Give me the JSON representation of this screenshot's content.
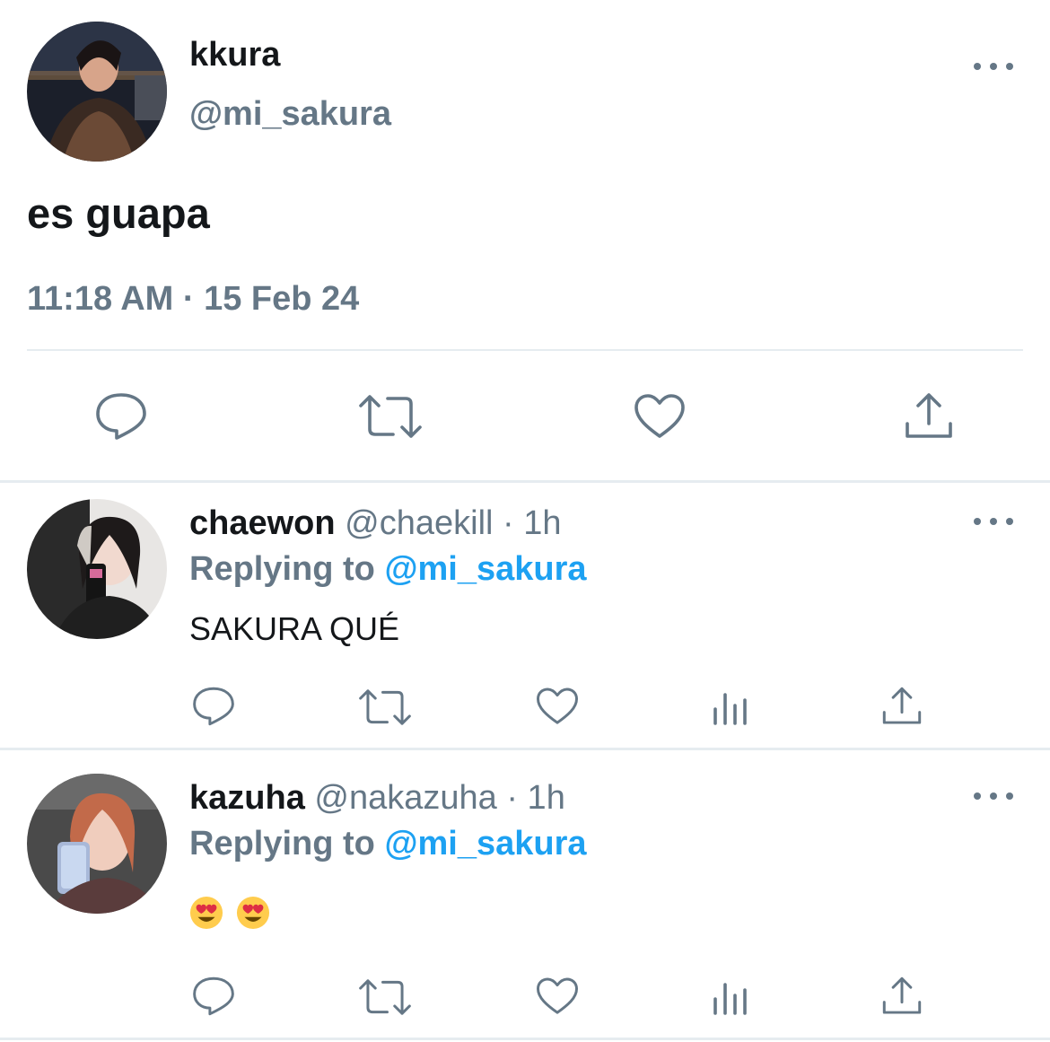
{
  "main_tweet": {
    "display_name": "kkura",
    "handle": "@mi_sakura",
    "text": "es guapa",
    "timestamp": "11:18 AM · 15 Feb 24",
    "avatar_icon": "avatar-photo"
  },
  "replies": [
    {
      "display_name": "chaewon",
      "handle": "@chaekill",
      "time": "· 1h",
      "replying_label": "Replying to",
      "replying_handle": "@mi_sakura",
      "text": "SAKURA QUÉ"
    },
    {
      "display_name": "kazuha",
      "handle": "@nakazuha",
      "time": "· 1h",
      "replying_label": "Replying to",
      "replying_handle": "@mi_sakura",
      "text": "",
      "emojis": [
        "heart-eyes-emoji",
        "heart-eyes-emoji"
      ]
    }
  ],
  "colors": {
    "text": "#14171a",
    "secondary": "#657786",
    "link": "#1da1f2",
    "divider": "#e6ecf0"
  }
}
